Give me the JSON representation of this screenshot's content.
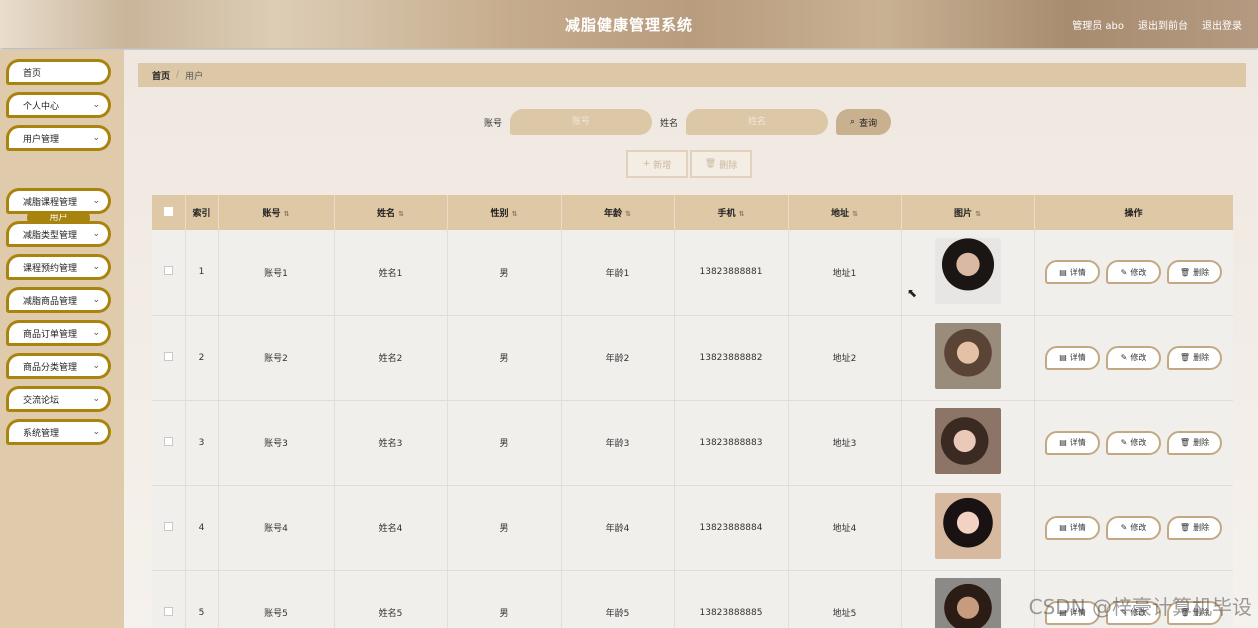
{
  "header": {
    "title": "减脂健康管理系统",
    "admin_label": "管理员 abo",
    "back_front": "退出到前台",
    "logout": "退出登录"
  },
  "sidebar": {
    "items": [
      {
        "label": "首页",
        "has_arrow": false
      },
      {
        "label": "个人中心",
        "has_arrow": true
      },
      {
        "label": "用户管理",
        "has_arrow": true
      },
      {
        "label": "减脂课程管理",
        "has_arrow": true
      },
      {
        "label": "减脂类型管理",
        "has_arrow": true
      },
      {
        "label": "课程预约管理",
        "has_arrow": true
      },
      {
        "label": "减脂商品管理",
        "has_arrow": true
      },
      {
        "label": "商品订单管理",
        "has_arrow": true
      },
      {
        "label": "商品分类管理",
        "has_arrow": true
      },
      {
        "label": "交流论坛",
        "has_arrow": true
      },
      {
        "label": "系统管理",
        "has_arrow": true
      }
    ],
    "active_sub": "用户"
  },
  "breadcrumb": {
    "home": "首页",
    "sep": "/",
    "current": "用户"
  },
  "search": {
    "account_label": "账号",
    "account_placeholder": "账号",
    "name_label": "姓名",
    "name_placeholder": "姓名",
    "query_label": "查询"
  },
  "actions": {
    "add": "新增",
    "delete": "删除"
  },
  "table": {
    "headers": [
      "索引",
      "账号",
      "姓名",
      "性别",
      "年龄",
      "手机",
      "地址",
      "图片",
      "操作"
    ],
    "rows": [
      {
        "index": "1",
        "account": "账号1",
        "name": "姓名1",
        "gender": "男",
        "age": "年龄1",
        "phone": "13823888881",
        "address": "地址1"
      },
      {
        "index": "2",
        "account": "账号2",
        "name": "姓名2",
        "gender": "男",
        "age": "年龄2",
        "phone": "13823888882",
        "address": "地址2"
      },
      {
        "index": "3",
        "account": "账号3",
        "name": "姓名3",
        "gender": "男",
        "age": "年龄3",
        "phone": "13823888883",
        "address": "地址3"
      },
      {
        "index": "4",
        "account": "账号4",
        "name": "姓名4",
        "gender": "男",
        "age": "年龄4",
        "phone": "13823888884",
        "address": "地址4"
      },
      {
        "index": "5",
        "account": "账号5",
        "name": "姓名5",
        "gender": "男",
        "age": "年龄5",
        "phone": "13823888885",
        "address": "地址5"
      }
    ],
    "ops": {
      "detail": "详情",
      "edit": "修改",
      "delete": "删除"
    }
  },
  "watermark": "CSDN @梓豪计算机毕设"
}
